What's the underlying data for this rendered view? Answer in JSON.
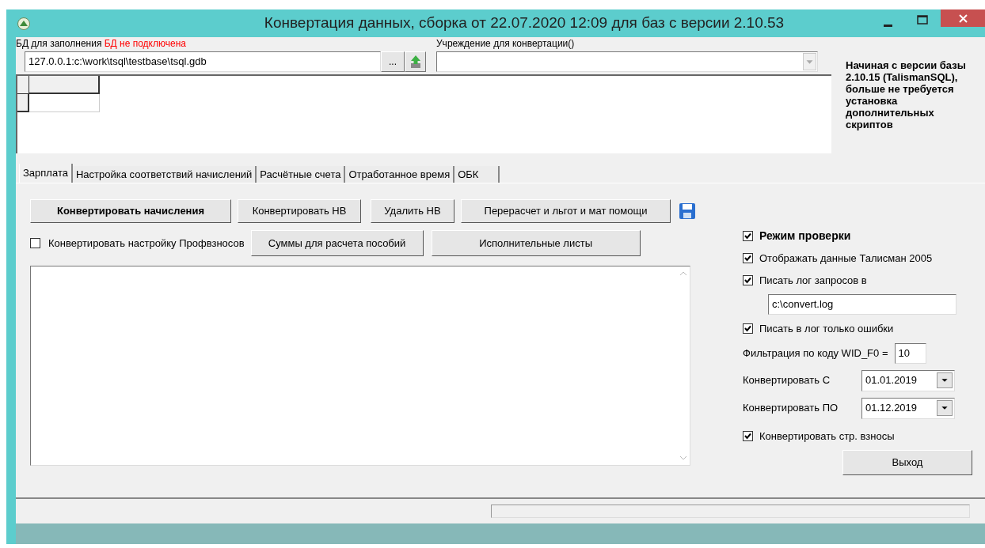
{
  "window": {
    "title": "Конвертация данных, сборка от 22.07.2020 12:09 для баз с версии 2.10.53"
  },
  "database": {
    "label": "БД для заполнения",
    "status": "БД не подключена",
    "value": "127.0.0.1:c:\\work\\tsql\\testbase\\tsql.gdb",
    "browse_button": "..."
  },
  "institution": {
    "label": "Учреждение для конвертации()"
  },
  "note": "Начиная с версии базы 2.10.15 (TalismanSQL), больше не требуется установка дополнительных скриптов",
  "tabs": [
    {
      "label": "Зарплата",
      "selected": true
    },
    {
      "label": "Настройка соответствий начислений",
      "selected": false
    },
    {
      "label": "Расчётные счета",
      "selected": false
    },
    {
      "label": "Отработанное время",
      "selected": false
    },
    {
      "label": "ОБК",
      "selected": false
    }
  ],
  "buttons_row1": [
    {
      "label": "Конвертировать начисления",
      "bold": true
    },
    {
      "label": "Конвертировать НВ",
      "bold": false
    },
    {
      "label": "Удалить НВ",
      "bold": false
    },
    {
      "label": "Перерасчет и льгот и мат помощи",
      "bold": false
    }
  ],
  "profvznosy": {
    "label": "Конвертировать настройку Профвзносов",
    "checked": false
  },
  "buttons_row2": [
    {
      "label": "Суммы для расчета пособий",
      "bold": false
    },
    {
      "label": "Исполнительные листы",
      "bold": false
    }
  ],
  "options": [
    {
      "kind": "checkbox",
      "label": "Режим проверки",
      "checked": true,
      "bold": true
    },
    {
      "kind": "checkbox",
      "label": "Отображать данные Талисман 2005",
      "checked": true,
      "bold": false
    },
    {
      "kind": "checkbox",
      "label": "Писать лог запросов в",
      "checked": true,
      "bold": false
    },
    {
      "kind": "path",
      "value": "c:\\convert.log"
    },
    {
      "kind": "checkbox",
      "label": "Писать в лог только ошибки",
      "checked": true,
      "bold": false
    },
    {
      "kind": "number",
      "label": "Фильтрация по коду WID_F0 =",
      "value": "10"
    },
    {
      "kind": "date",
      "label": "Конвертировать С",
      "value": "01.01.2019"
    },
    {
      "kind": "date",
      "label": "Конвертировать ПО",
      "value": "01.12.2019"
    },
    {
      "kind": "checkbox",
      "label": "Конвертировать стр. взносы",
      "checked": true,
      "bold": false
    }
  ],
  "exit_button": "Выход"
}
